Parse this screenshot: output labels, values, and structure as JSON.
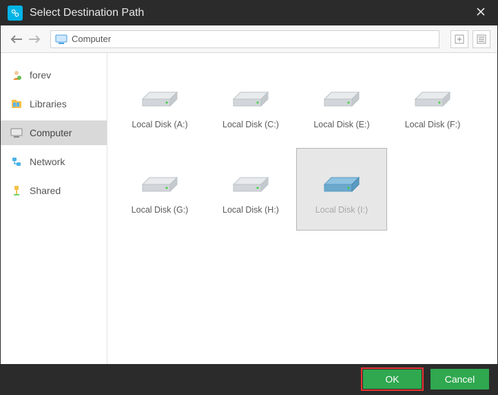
{
  "window": {
    "title": "Select Destination Path"
  },
  "toolbar": {
    "path": "Computer"
  },
  "sidebar": {
    "items": [
      {
        "label": "forev",
        "icon": "user-icon"
      },
      {
        "label": "Libraries",
        "icon": "libraries-icon"
      },
      {
        "label": "Computer",
        "icon": "computer-icon"
      },
      {
        "label": "Network",
        "icon": "network-icon"
      },
      {
        "label": "Shared",
        "icon": "shared-icon"
      }
    ],
    "active_index": 2
  },
  "disks": [
    {
      "label": "Local Disk (A:)",
      "selected": false
    },
    {
      "label": "Local Disk (C:)",
      "selected": false
    },
    {
      "label": "Local Disk (E:)",
      "selected": false
    },
    {
      "label": "Local Disk (F:)",
      "selected": false
    },
    {
      "label": "Local Disk (G:)",
      "selected": false
    },
    {
      "label": "Local Disk (H:)",
      "selected": false
    },
    {
      "label": "Local Disk (I:)",
      "selected": true
    }
  ],
  "footer": {
    "ok": "OK",
    "cancel": "Cancel"
  }
}
